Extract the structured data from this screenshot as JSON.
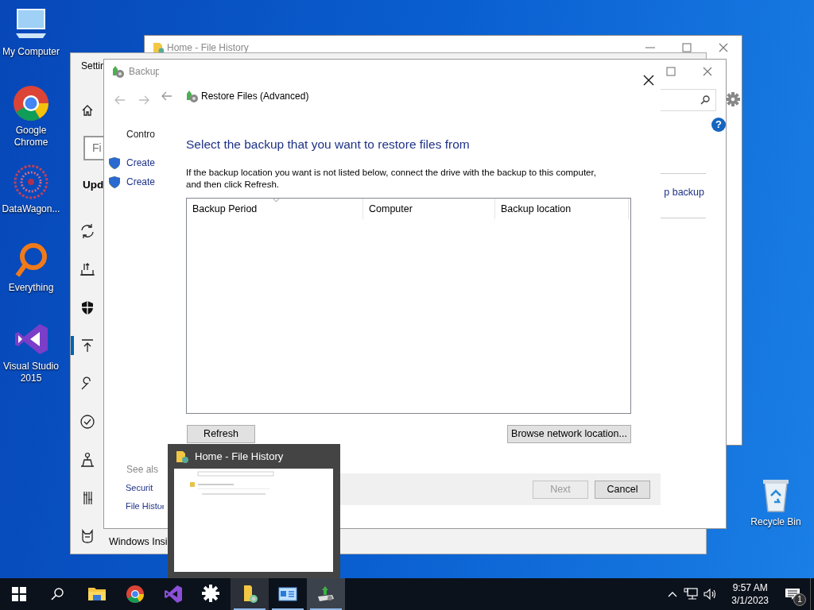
{
  "desktop": {
    "icons": [
      {
        "label": "My Computer",
        "kind": "computer"
      },
      {
        "label": "Google Chrome",
        "kind": "chrome"
      },
      {
        "label": "DataWagon...",
        "kind": "datawagon"
      },
      {
        "label": "Everything",
        "kind": "everything"
      },
      {
        "label": "Visual Studio 2015",
        "kind": "vs"
      }
    ],
    "recycle_bin": {
      "label": "Recycle Bin"
    }
  },
  "file_history_window": {
    "title": "Home - File History"
  },
  "settings_window": {
    "title": "Settin",
    "search": {
      "placeholder": "Fi"
    },
    "heading": "Upd",
    "nav_items": [
      {
        "kind": "sync",
        "selected": false
      },
      {
        "kind": "backup",
        "selected": false
      },
      {
        "kind": "security",
        "selected": false
      },
      {
        "kind": "upload",
        "selected": true
      },
      {
        "kind": "troubleshoot",
        "selected": false
      },
      {
        "kind": "activation",
        "selected": false
      },
      {
        "kind": "find",
        "selected": false
      },
      {
        "kind": "developer",
        "selected": false
      },
      {
        "kind": "insider",
        "label": "Windows Insi",
        "selected": false
      }
    ]
  },
  "backup_window": {
    "title": "Backup",
    "sidebar_title": "Contro",
    "tasks": [
      "Create",
      "Create"
    ],
    "link": "p backup",
    "help_label": "?",
    "see_also_heading": "See als",
    "see_also": [
      "Securit",
      "File Histor"
    ]
  },
  "restore_dialog": {
    "title": "Restore Files (Advanced)",
    "heading": "Select the backup that you want to restore files from",
    "instructions": "If the backup location you want is not listed below, connect the drive with the backup to this computer, and then click Refresh.",
    "columns": [
      {
        "label": "Backup Period",
        "sorted": true
      },
      {
        "label": "Computer",
        "sorted": false
      },
      {
        "label": "Backup location",
        "sorted": false
      }
    ],
    "refresh_button": "Refresh",
    "browse_button": "Browse network location...",
    "footer_buttons": [
      {
        "label": "Next",
        "disabled": true
      },
      {
        "label": "Cancel",
        "disabled": false
      }
    ]
  },
  "taskbar_preview": {
    "title": "Home - File History"
  },
  "taskbar": {
    "apps": [
      {
        "kind": "explorer",
        "open": false,
        "hovered": false,
        "active": false
      },
      {
        "kind": "chrome",
        "open": false,
        "hovered": false,
        "active": false
      },
      {
        "kind": "vs",
        "open": false,
        "hovered": false,
        "active": false
      },
      {
        "kind": "settings",
        "open": false,
        "hovered": false,
        "active": false
      },
      {
        "kind": "file_history",
        "open": true,
        "hovered": true,
        "active": false
      },
      {
        "kind": "control_panel",
        "open": true,
        "hovered": false,
        "active": false
      },
      {
        "kind": "backup",
        "open": true,
        "hovered": false,
        "active": true
      }
    ],
    "time": "9:57 AM",
    "date": "3/1/2023",
    "notification_count": "1"
  }
}
